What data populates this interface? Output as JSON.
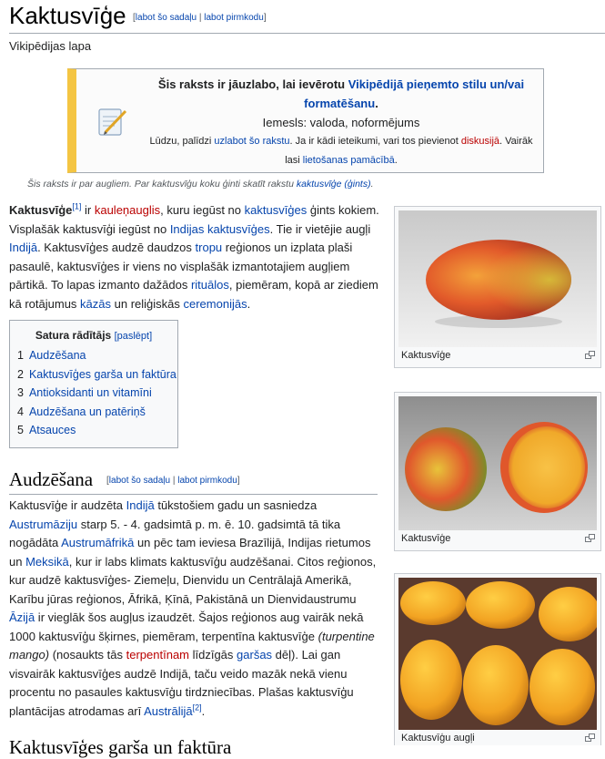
{
  "title": "Kaktusvīģe",
  "edit": {
    "open": "[",
    "edit": "labot šo sadaļu",
    "sep": " | ",
    "source": "labot pirmkodu",
    "close": "]"
  },
  "subtitle": "Vikipēdijas lapa",
  "notice": {
    "l1": "Šis raksts ir jāuzlabo, lai ievērotu ",
    "l1_link": "Vikipēdijā pieņemto stilu un/vai formatēšanu",
    "l1_end": ".",
    "reason": "Iemesls: valoda, noformējums",
    "fine1": "Lūdzu, palīdzi ",
    "fine_link1": "uzlabot šo rakstu",
    "fine2": ". Ja ir kādi ieteikumi, vari tos pievienot ",
    "fine_link2": "diskusijā",
    "fine3": ". Vairāk lasi ",
    "fine_link3": "lietošanas pamācībā",
    "fine4": "."
  },
  "hatnote": {
    "text": "Šis raksts ir par augliem. Par kaktusvīģu koku ģinti skatīt rakstu ",
    "link": "kaktusvīģe (ģints)",
    "end": "."
  },
  "intro": {
    "bold": "Kaktusvīģe",
    "ref1": "[1]",
    "t1": " ir ",
    "l1": "kauleņauglis",
    "t2": ", kuru iegūst no ",
    "l2": "kaktusvīģes",
    "t3": " ģints kokiem. Visplašāk kaktusvīģi iegūst no ",
    "l3": "Indijas kaktusvīģes",
    "t4": ". Tie ir vietējie augļi ",
    "l4": "Indijā",
    "t5": ". Kaktusvīģes audzē daudzos ",
    "l5": "tropu",
    "t6": " reģionos un izplata plaši pasaulē, kaktusvīģes ir viens no visplašāk izmantotajiem augļiem pārtikā. To lapas izmanto dažādos ",
    "l6": "rituālos",
    "t7": ", piemēram, kopā ar ziediem kā rotājumus ",
    "l7": "kāzās",
    "t8": " un reliģiskās ",
    "l8": "ceremonijās",
    "t9": "."
  },
  "toc": {
    "title": "Satura rādītājs",
    "toggle": "[paslēpt]",
    "items": [
      {
        "num": "1",
        "label": "Audzēšana"
      },
      {
        "num": "2",
        "label": "Kaktusvīģes garša un faktūra"
      },
      {
        "num": "3",
        "label": "Antioksidanti un vitamīni"
      },
      {
        "num": "4",
        "label": "Audzēšana un patēriņš"
      },
      {
        "num": "5",
        "label": "Atsauces"
      }
    ]
  },
  "section1": {
    "heading": "Audzēšana",
    "t1": "Kaktusvīģe ir audzēta ",
    "l1": "Indijā",
    "t2": " tūkstošiem gadu un sasniedza ",
    "l2": "Austrumāziju",
    "t3": " starp 5. - 4. gadsimtā p. m. ē. 10. gadsimtā tā tika nogādāta ",
    "l3": "Austrumāfrikā",
    "t4": " un pēc tam ieviesa Brazīlijā, Indijas rietumos un ",
    "l4": "Meksikā",
    "t5": ", kur ir labs klimats kaktusvīģu audzēšanai. Citos reģionos, kur audzē kaktusvīģes- Ziemeļu, Dienvidu un Centrālajā Amerikā, Karību jūras reģionos, Āfrikā, Ķīnā, Pakistānā un Dienvidaustrumu ",
    "l5": "Āzijā",
    "t6": " ir vieglāk šos augļus izaudzēt. Šajos reģionos aug vairāk nekā 1000 kaktusvīģu šķirnes, piemēram, terpentīna kaktusvīģe ",
    "i1": "(turpentine mango)",
    "t7": " (nosaukts tās ",
    "l6": "terpentīnam",
    "t8": " līdzīgās ",
    "l7": "garšas",
    "t9": " dēļ). Lai gan visvairāk kaktusvīģes audzē Indijā, taču veido mazāk nekā vienu procentu no pasaules kaktusvīģu tirdzniecības. Plašas kaktusvīģu plantācijas atrodamas arī ",
    "l8": "Austrālijā",
    "ref2": "[2]",
    "t10": "."
  },
  "next_heading": "Kaktusvīģes garša un faktūra",
  "thumbs": [
    {
      "caption": "Kaktusvīģe"
    },
    {
      "caption": "Kaktusvīģe"
    },
    {
      "caption": "Kaktusvīģu augļi"
    }
  ],
  "colors": {
    "link": "#0645ad",
    "redlink": "#ba0000",
    "notice_bar": "#f4c542",
    "border": "#a2a9b1"
  }
}
